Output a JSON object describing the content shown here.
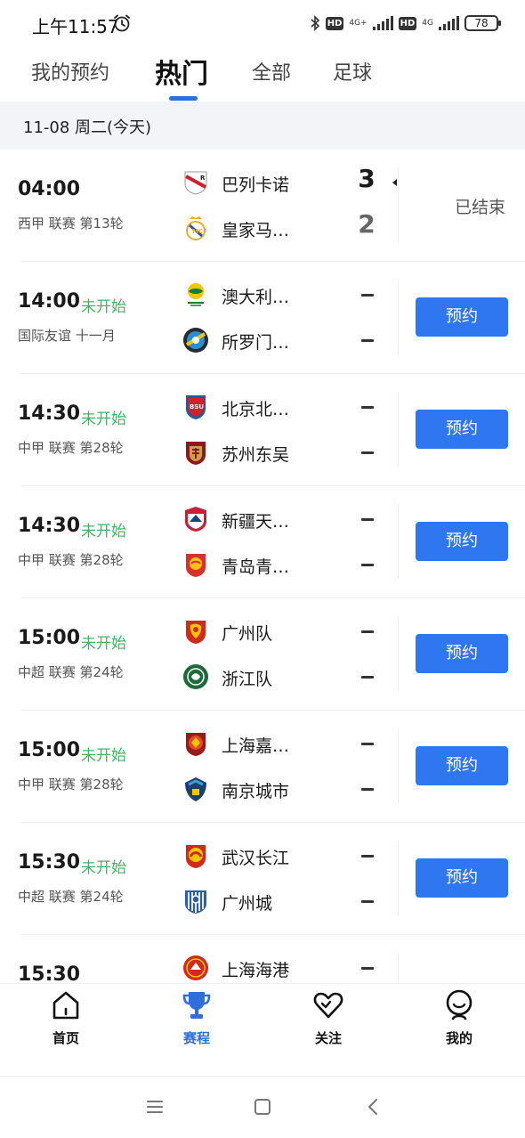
{
  "status_bar": {
    "time": "上午11:57",
    "network_1": "4G+",
    "network_2": "4G",
    "hd": "HD",
    "battery": "78"
  },
  "top_tabs": [
    {
      "label": "我的预约"
    },
    {
      "label": "热门"
    },
    {
      "label": "全部"
    },
    {
      "label": "足球"
    }
  ],
  "date_header": "11-08 周二(今天)",
  "matches": [
    {
      "time": "04:00",
      "status": "",
      "league": "西甲 联赛 第13轮",
      "home": {
        "name": "巴列卡诺",
        "logo": "rayo-vallecano-crest",
        "score": "3"
      },
      "away": {
        "name": "皇家马…",
        "logo": "real-madrid-crest",
        "score": "2"
      },
      "action": "已结束"
    },
    {
      "time": "14:00",
      "status": "未开始",
      "league": "国际友谊 十一月",
      "home": {
        "name": "澳大利…",
        "logo": "australia-crest",
        "score": ""
      },
      "away": {
        "name": "所罗门…",
        "logo": "solomon-crest",
        "score": ""
      },
      "action": "预约"
    },
    {
      "time": "14:30",
      "status": "未开始",
      "league": "中甲 联赛 第28轮",
      "home": {
        "name": "北京北…",
        "logo": "beijing-bsu-crest",
        "score": ""
      },
      "away": {
        "name": "苏州东吴",
        "logo": "suzhou-dongwu-crest",
        "score": ""
      },
      "action": "预约"
    },
    {
      "time": "14:30",
      "status": "未开始",
      "league": "中甲 联赛 第28轮",
      "home": {
        "name": "新疆天…",
        "logo": "xinjiang-crest",
        "score": ""
      },
      "away": {
        "name": "青岛青…",
        "logo": "qingdao-crest",
        "score": ""
      },
      "action": "预约"
    },
    {
      "time": "15:00",
      "status": "未开始",
      "league": "中超 联赛 第24轮",
      "home": {
        "name": "广州队",
        "logo": "guangzhou-crest",
        "score": ""
      },
      "away": {
        "name": "浙江队",
        "logo": "zhejiang-crest",
        "score": ""
      },
      "action": "预约"
    },
    {
      "time": "15:00",
      "status": "未开始",
      "league": "中甲 联赛 第28轮",
      "home": {
        "name": "上海嘉…",
        "logo": "shanghai-jiading-crest",
        "score": ""
      },
      "away": {
        "name": "南京城市",
        "logo": "nanjing-city-crest",
        "score": ""
      },
      "action": "预约"
    },
    {
      "time": "15:30",
      "status": "未开始",
      "league": "中超 联赛 第24轮",
      "home": {
        "name": "武汉长江",
        "logo": "wuhan-crest",
        "score": ""
      },
      "away": {
        "name": "广州城",
        "logo": "guangzhou-city-crest",
        "score": ""
      },
      "action": "预约"
    },
    {
      "time": "15:30",
      "status": "",
      "league": "",
      "home": {
        "name": "上海海港",
        "logo": "shanghai-port-crest",
        "score": ""
      },
      "away": {
        "name": "",
        "logo": "",
        "score": ""
      },
      "action": ""
    }
  ],
  "bottom_nav": [
    {
      "label": "首页",
      "icon": "home-icon"
    },
    {
      "label": "赛程",
      "icon": "trophy-icon"
    },
    {
      "label": "关注",
      "icon": "heart-icon"
    },
    {
      "label": "我的",
      "icon": "profile-icon"
    }
  ],
  "colors": {
    "accent": "#2f6fdc",
    "button": "#2f77f0",
    "status_green": "#3fb660",
    "date_bg": "#f2f4f8"
  }
}
